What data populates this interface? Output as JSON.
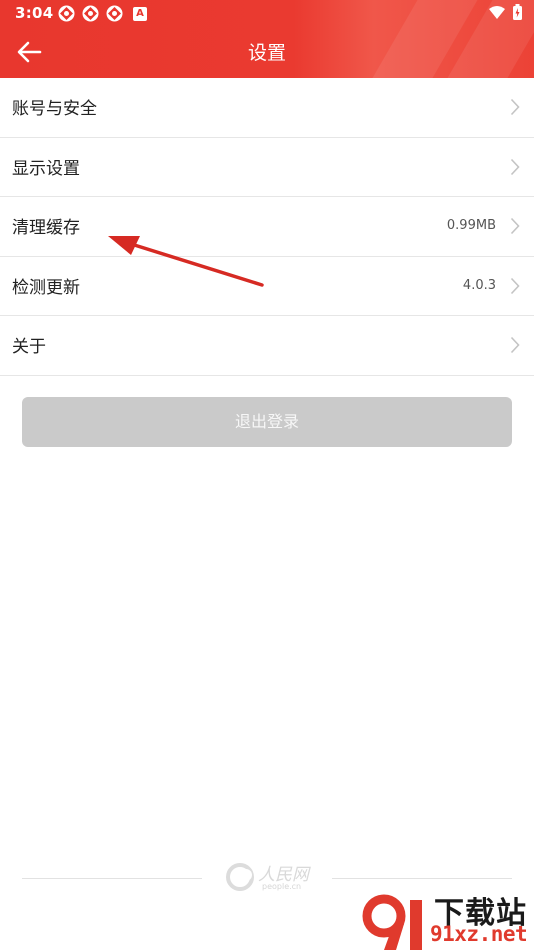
{
  "status_bar": {
    "time": "3:04",
    "notification_badge": "A"
  },
  "app_bar": {
    "title": "设置"
  },
  "settings": [
    {
      "label": "账号与安全",
      "value": ""
    },
    {
      "label": "显示设置",
      "value": ""
    },
    {
      "label": "清理缓存",
      "value": "0.99MB"
    },
    {
      "label": "检测更新",
      "value": "4.0.3"
    },
    {
      "label": "关于",
      "value": ""
    }
  ],
  "logout_label": "退出登录",
  "footer": {
    "logo_cn": "人民网",
    "logo_en": "people.cn"
  },
  "watermark": {
    "cn": "下载站",
    "en": "91xz.net"
  },
  "colors": {
    "header": "#e8372e",
    "logout_bg": "#cacaca",
    "arrow": "#d62a23"
  },
  "icons": [
    "back-arrow-icon",
    "chevron-right-icon",
    "wifi-icon",
    "battery-icon",
    "notification-icon"
  ]
}
